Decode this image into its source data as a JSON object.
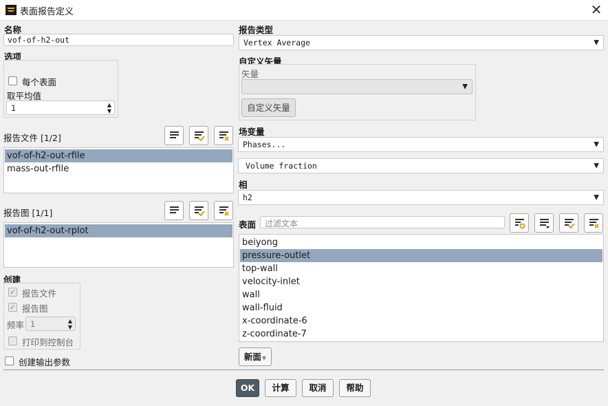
{
  "window": {
    "title": "表面报告定义",
    "close_label": "✕"
  },
  "name": {
    "label": "名称",
    "value": "vof-of-h2-out"
  },
  "options": {
    "label": "选项",
    "per_surface_label": "每个表面",
    "average_over_label": "取平均值",
    "average_over_value": "1"
  },
  "report_files": {
    "label": "报告文件 [1/2]",
    "items": [
      "vof-of-h2-out-rfile",
      "mass-out-rfile"
    ]
  },
  "report_plots": {
    "label": "报告图 [1/1]",
    "items": [
      "vof-of-h2-out-rplot"
    ]
  },
  "create": {
    "label": "创建",
    "report_file_label": "报告文件",
    "report_plot_label": "报告图",
    "frequency_label": "频率",
    "frequency_value": "1",
    "print_console_label": "打印到控制台"
  },
  "create_output_param_label": "创建输出参数",
  "report_type": {
    "label": "报告类型",
    "value": "Vertex Average"
  },
  "custom_vectors": {
    "label": "自定义矢量",
    "vectors_label": "矢量",
    "vectors_value": "",
    "button_label": "自定义矢量"
  },
  "field_variable": {
    "label": "场变量",
    "category_value": "Phases...",
    "variable_value": "Volume fraction"
  },
  "phase": {
    "label": "相",
    "value": "h2"
  },
  "surfaces": {
    "label": "表面",
    "filter_placeholder": "过滤文本",
    "items": [
      "beiyong",
      "pressure-outlet",
      "top-wall",
      "velocity-inlet",
      "wall",
      "wall-fluid",
      "x-coordinate-6",
      "z-coordinate-7"
    ],
    "selected": "pressure-outlet",
    "new_surface_label": "新面"
  },
  "buttons": {
    "ok": "OK",
    "compute": "计算",
    "cancel": "取消",
    "help": "帮助"
  },
  "colors": {
    "selection": "#93a7bd",
    "ok_button": "#4f5c68",
    "check_accent": "#d4a017",
    "clear_accent": "#e0a800"
  }
}
